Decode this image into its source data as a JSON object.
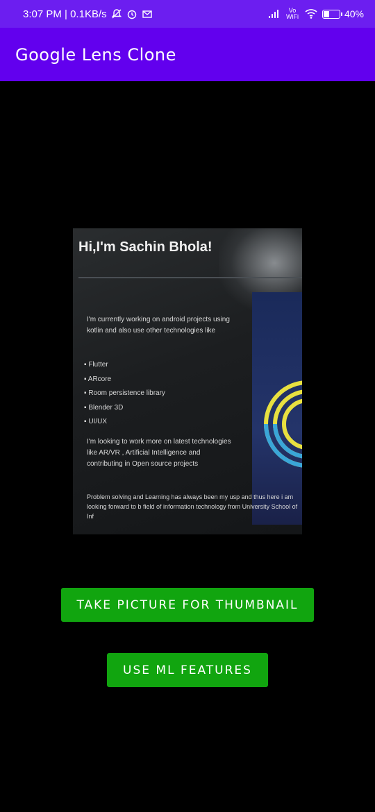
{
  "status_bar": {
    "left_text": "3:07 PM | 0.1KB/s",
    "right_network": "Vo WiFi",
    "battery": "40%",
    "battery_level": 0.4
  },
  "app_bar": {
    "title": "Google Lens Clone"
  },
  "thumbnail": {
    "heading": "Hi,I'm Sachin Bhola!",
    "intro": "I'm currently working on android projects using kotlin and also use other technologies like",
    "list": [
      "Flutter",
      "ARcore",
      "Room persistence library",
      "Blender 3D",
      "UI/UX"
    ],
    "para2": "I'm looking to work more on latest technologies like AR/VR , Artificial Intelligence and contributing in Open source projects",
    "para3": "Problem solving and Learning has always been my usp and thus here i am looking forward to b field of information technology from University School of Inf"
  },
  "buttons": {
    "take_picture": "TAKE PICTURE FOR THUMBNAIL",
    "ml_features": "USE ML FEATURES"
  },
  "colors": {
    "status_bar": "#6c1ef0",
    "app_bar": "#6200ee",
    "button": "#11a50f",
    "background": "#000000"
  }
}
